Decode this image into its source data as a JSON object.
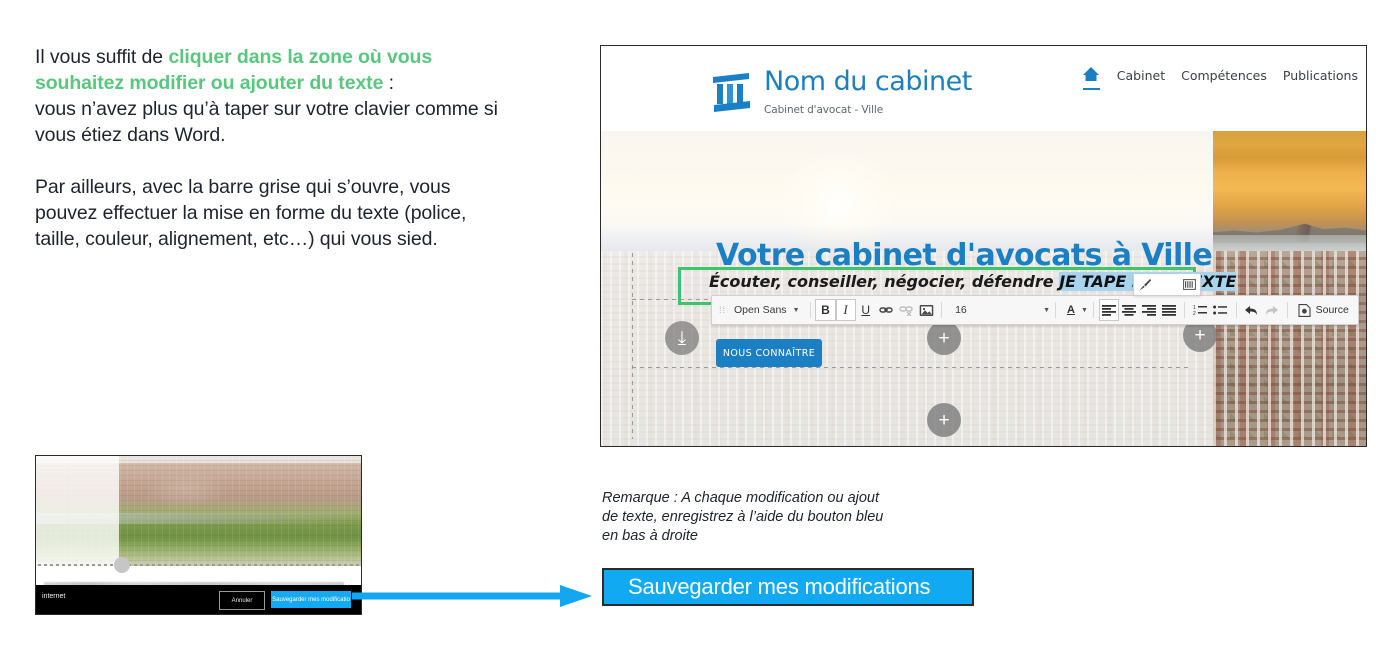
{
  "instructions": {
    "p1_lead": "Il vous suffit de ",
    "p1_green": "cliquer dans la zone où vous souhaitez modifier ou ajouter du texte",
    "p1_colon": " :",
    "p1_rest": "vous n’avez plus qu’à taper sur votre clavier comme si vous étiez dans Word.",
    "p2": "Par ailleurs, avec la barre grise qui s’ouvre, vous pouvez effectuer la mise en forme du texte (police, taille, couleur, alignement, etc…) qui vous sied.",
    "green_color": "#5ac77f"
  },
  "thumbnail": {
    "status_label": "internet",
    "cancel_label": "Annuler",
    "save_label": "Sauvegarder mes modificatio"
  },
  "site": {
    "brand": {
      "name": "Nom du cabinet",
      "tagline": "Cabinet d'avocat - Ville",
      "logo_icon": "law-column-icon",
      "accent_color": "#1b7fc4"
    },
    "nav": {
      "home_icon": "home-icon",
      "links": [
        "Cabinet",
        "Compétences",
        "Publications"
      ]
    },
    "hero": {
      "title": "Votre cabinet d'avocats à Ville",
      "subtitle_static": "Écouter, conseiller, négocier, défendre ",
      "subtitle_typed": "JE TAPE MON TEXTE",
      "cta_label": "NOUS CONNAÎTRE",
      "selection_color": "#a8d4ef",
      "highlight_box_color": "#3ec46b",
      "add_block_icon": "plus-circle-icon",
      "move_handle_icon": "move-handle-icon"
    },
    "toolbar": {
      "grip_icon": "drag-grip-icon",
      "font_name": "Open Sans",
      "font_caret_icon": "chevron-down-icon",
      "bold_label": "B",
      "bold_icon": "bold-icon",
      "italic_label": "I",
      "italic_icon": "italic-icon",
      "underline_label": "U",
      "underline_icon": "underline-icon",
      "link_icon": "link-icon",
      "unlink_icon": "unlink-icon",
      "image_icon": "image-icon",
      "font_size": "16",
      "size_caret_icon": "chevron-down-icon",
      "text_color_label": "A",
      "text_color_icon": "text-color-icon",
      "align_left_icon": "align-left-icon",
      "align_center_icon": "align-center-icon",
      "align_right_icon": "align-right-icon",
      "align_justify_icon": "align-justify-icon",
      "ordered_list_icon": "numbered-list-icon",
      "unordered_list_icon": "bulleted-list-icon",
      "undo_icon": "undo-icon",
      "redo_icon": "redo-icon",
      "source_label": "Source",
      "source_icon": "source-code-icon"
    },
    "mini_panel": {
      "brush_icon": "brush-icon",
      "grid_icon": "grid-icon"
    }
  },
  "remark": {
    "line1": "Remarque : A chaque modification ou ajout",
    "line2": "de texte, enregistrez à l’aide du bouton bleu",
    "line3": "en bas à droite"
  },
  "save_button": {
    "label": "Sauvegarder mes modifications",
    "color": "#11aaf2"
  },
  "arrow": {
    "icon": "right-arrow-icon",
    "color": "#12a7f0"
  }
}
